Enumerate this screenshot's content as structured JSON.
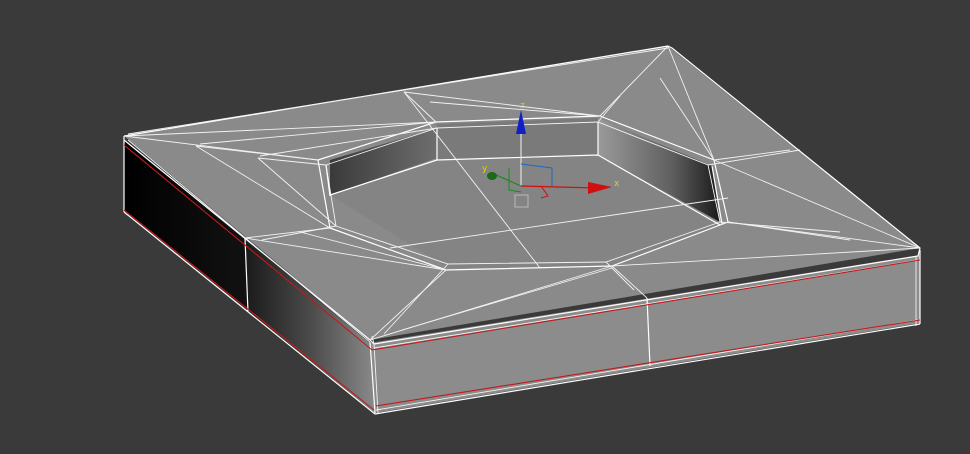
{
  "viewport": {
    "background": "#3a3a3a"
  },
  "model": {
    "top_color": "#8a8a8a",
    "cavity_floor_color": "#858585",
    "side_front_color": "#8c8c8c",
    "wire_color": "#ffffff",
    "selection_edge_color": "#c21a1a"
  },
  "gizmo": {
    "x_label": "x",
    "y_label": "y",
    "z_label": "z",
    "x_color": "#d01010",
    "y_color": "#1a8a1a",
    "z_color": "#1020c8",
    "plane_color": "#d8d800"
  }
}
